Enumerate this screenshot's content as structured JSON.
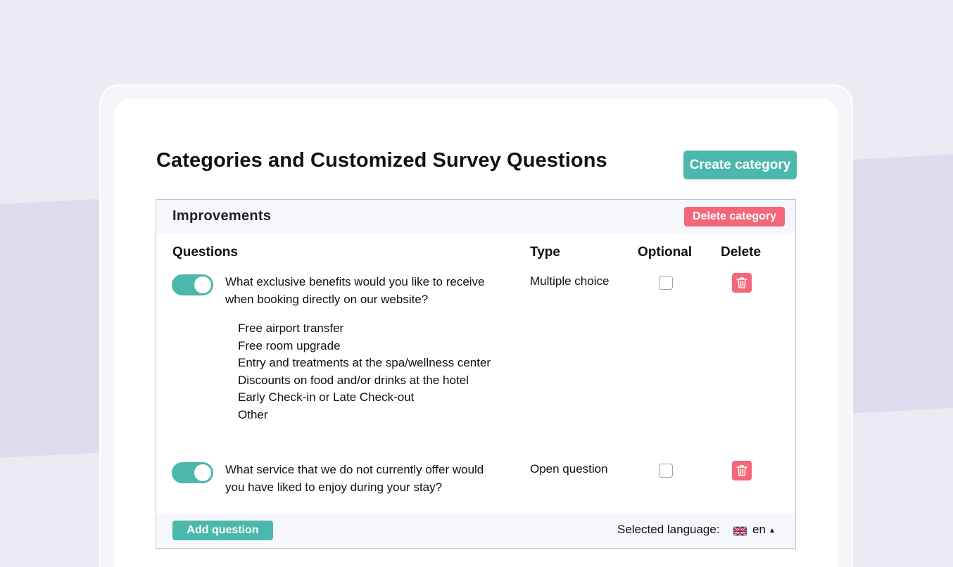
{
  "page": {
    "title": "Categories and Customized Survey Questions",
    "create_button": "Create category"
  },
  "category": {
    "name": "Improvements",
    "delete_button": "Delete category",
    "columns": {
      "questions": "Questions",
      "type": "Type",
      "optional": "Optional",
      "delete": "Delete"
    },
    "questions": [
      {
        "enabled": true,
        "text": "What exclusive benefits would you like to receive when booking directly on our website?",
        "type": "Multiple choice",
        "optional": false,
        "options": [
          "Free airport transfer",
          "Free room upgrade",
          "Entry and treatments at the spa/wellness center",
          "Discounts on food and/or drinks at the hotel",
          "Early Check-in or Late Check-out",
          "Other"
        ]
      },
      {
        "enabled": true,
        "text": "What service that we do not currently offer would you have liked to enjoy during your stay?",
        "type": "Open question",
        "optional": false
      }
    ],
    "footer": {
      "add_button": "Add question",
      "language_label": "Selected language:",
      "language_code": "en",
      "language_flag_icon": "uk-flag-icon"
    }
  },
  "colors": {
    "accent": "#4cb8ac",
    "danger": "#f46778",
    "background": "#ebebf4"
  }
}
